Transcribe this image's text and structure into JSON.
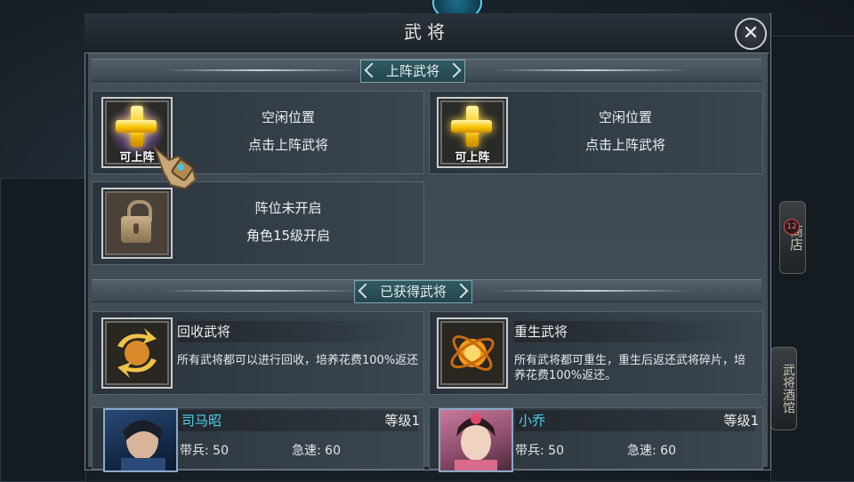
{
  "window": {
    "title": "武将",
    "close_icon": "close-icon"
  },
  "side_buttons": {
    "shop": "商店",
    "shop_badge": "12",
    "tavern": "武将酒馆"
  },
  "deploy_section": {
    "header": "上阵武将",
    "slots": [
      {
        "icon": "plus-icon",
        "badge": "可上阵",
        "line1": "空闲位置",
        "line2": "点击上阵武将"
      },
      {
        "icon": "plus-icon",
        "badge": "可上阵",
        "line1": "空闲位置",
        "line2": "点击上阵武将"
      },
      {
        "icon": "lock-icon",
        "line1": "阵位未开启",
        "line2": "角色15级开启"
      }
    ]
  },
  "owned_section": {
    "header": "已获得武将",
    "features": [
      {
        "icon": "recycle-icon",
        "title": "回收武将",
        "desc": "所有武将都可以进行回收，培养花费100%返还"
      },
      {
        "icon": "rebirth-icon",
        "title": "重生武将",
        "desc": "所有武将都可重生，重生后返还武将碎片，培养花费100%返还。"
      }
    ],
    "heroes": [
      {
        "name": "司马昭",
        "level": "等级1",
        "troops_label": "带兵:",
        "troops": "50",
        "speed_label": "急速:",
        "speed": "60"
      },
      {
        "name": "小乔",
        "level": "等级1",
        "troops_label": "带兵:",
        "troops": "50",
        "speed_label": "急速:",
        "speed": "60"
      }
    ]
  },
  "colors": {
    "hero_name": "#4ad6f0",
    "plus_gold": "#f5c400",
    "panel_bg": "#3d4852"
  }
}
